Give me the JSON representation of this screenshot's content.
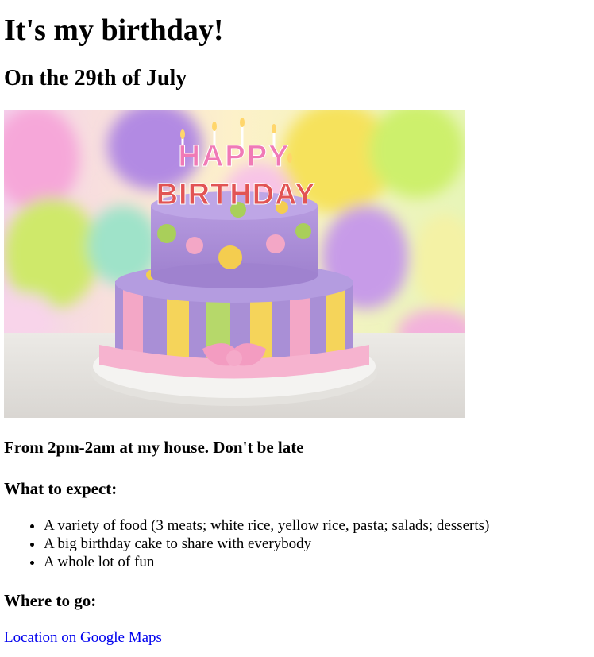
{
  "title": "It's my birthday!",
  "date": "On the 29th of July",
  "image": {
    "topper_line1": "HAPPY",
    "topper_line2": "BIRTHDAY",
    "colors": {
      "cake_purple": "#a98fd6",
      "stripe_yellow": "#f5d45a",
      "stripe_green": "#b6d86a",
      "stripe_pink": "#f3a7c6",
      "ribbon_pink": "#f6b3cf",
      "dot_green": "#a9cf5a",
      "dot_yellow": "#f4cd4f",
      "plate": "#f2f1ef"
    }
  },
  "when": "From 2pm-2am at my house. Don't be late",
  "expect_heading": "What to expect:",
  "expect_items": [
    "A variety of food (3 meats; white rice, yellow rice, pasta; salads; desserts)",
    "A big birthday cake to share with everybody",
    "A whole lot of fun"
  ],
  "where_heading": "Where to go:",
  "map_link": "Location on Google Maps"
}
